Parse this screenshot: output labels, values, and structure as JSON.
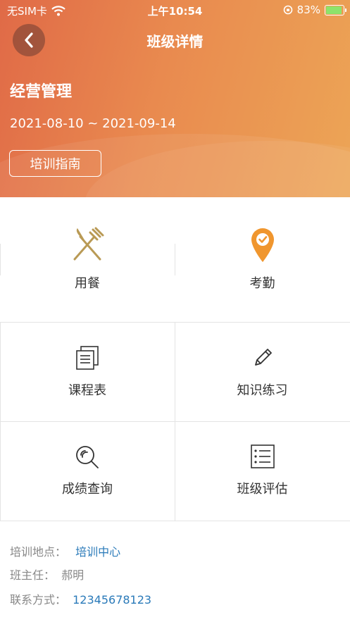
{
  "status_bar": {
    "carrier": "无SIM卡",
    "time": "上午10:54",
    "battery_percent": "83%",
    "battery_level": 0.83
  },
  "nav": {
    "title": "班级详情"
  },
  "class_info": {
    "name": "经营管理",
    "dates": "2021-08-10 ~ 2021-09-14",
    "guide_button": "培训指南"
  },
  "menu": {
    "dining": "用餐",
    "attendance": "考勤",
    "schedule": "课程表",
    "practice": "知识练习",
    "grades": "成绩查询",
    "evaluation": "班级评估"
  },
  "details": {
    "location_label": "培训地点：",
    "location_value": "培训中心",
    "head_teacher_label": "班主任：",
    "head_teacher_value": "郝明",
    "contact_label": "联系方式：",
    "contact_value": "12345678123"
  },
  "colors": {
    "gradient_start": "#e06a47",
    "gradient_end": "#eca556",
    "link_blue": "#2a7ab9",
    "icon_gold": "#b99a55",
    "icon_orange": "#f0962e"
  }
}
